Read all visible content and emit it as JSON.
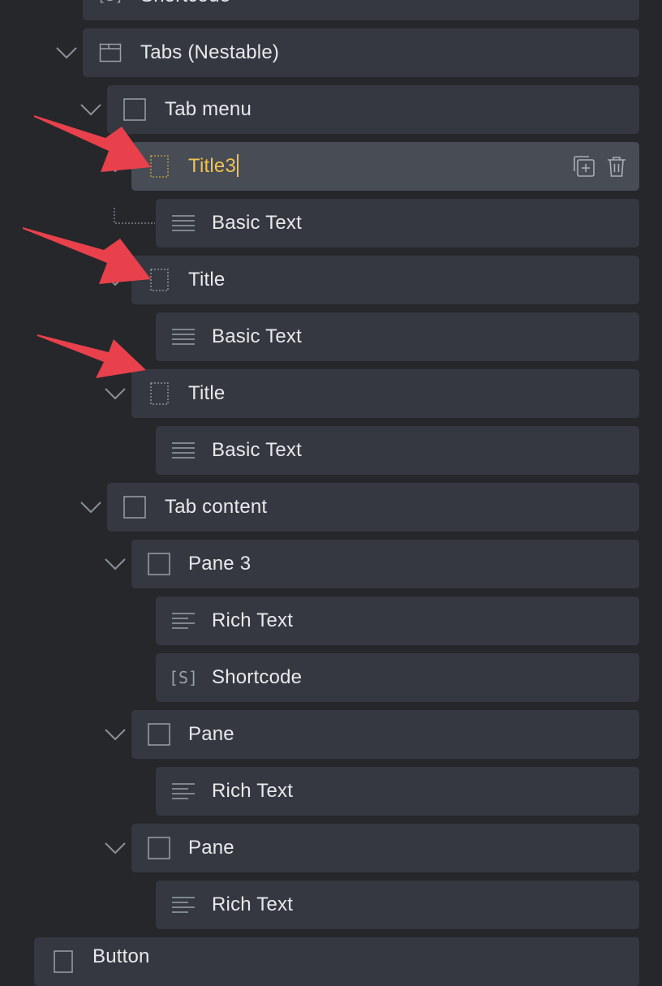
{
  "tree": {
    "rows": [
      {
        "label": "Shortcode",
        "icon": "shortcode-icon"
      },
      {
        "label": "Tabs (Nestable)",
        "icon": "folder-icon"
      },
      {
        "label": "Tab menu",
        "icon": "square-icon"
      },
      {
        "label": "Title3",
        "icon": "dashed-rect-icon",
        "selected": true
      },
      {
        "label": "Basic Text",
        "icon": "paragraph-icon"
      },
      {
        "label": "Title",
        "icon": "dashed-rect-icon"
      },
      {
        "label": "Basic Text",
        "icon": "paragraph-icon"
      },
      {
        "label": "Title",
        "icon": "dashed-rect-icon"
      },
      {
        "label": "Basic Text",
        "icon": "paragraph-icon"
      },
      {
        "label": "Tab content",
        "icon": "square-icon"
      },
      {
        "label": "Pane 3",
        "icon": "square-icon"
      },
      {
        "label": "Rich Text",
        "icon": "rich-text-icon"
      },
      {
        "label": "Shortcode",
        "icon": "shortcode-icon"
      },
      {
        "label": "Pane",
        "icon": "square-icon"
      },
      {
        "label": "Rich Text",
        "icon": "rich-text-icon"
      },
      {
        "label": "Pane",
        "icon": "square-icon"
      },
      {
        "label": "Rich Text",
        "icon": "rich-text-icon"
      },
      {
        "label": "Button",
        "icon": "square-icon"
      }
    ],
    "row_actions": [
      "duplicate-icon",
      "trash-icon"
    ]
  },
  "annotations": {
    "arrows": [
      "arrow-pointer",
      "arrow-pointer",
      "arrow-pointer"
    ],
    "arrow_color": "#e8414b"
  },
  "colors": {
    "background": "#25272b",
    "row": "#353840",
    "selected_row": "#474c55",
    "selected_text": "#f2c14e",
    "icon": "#9aa0a8"
  }
}
